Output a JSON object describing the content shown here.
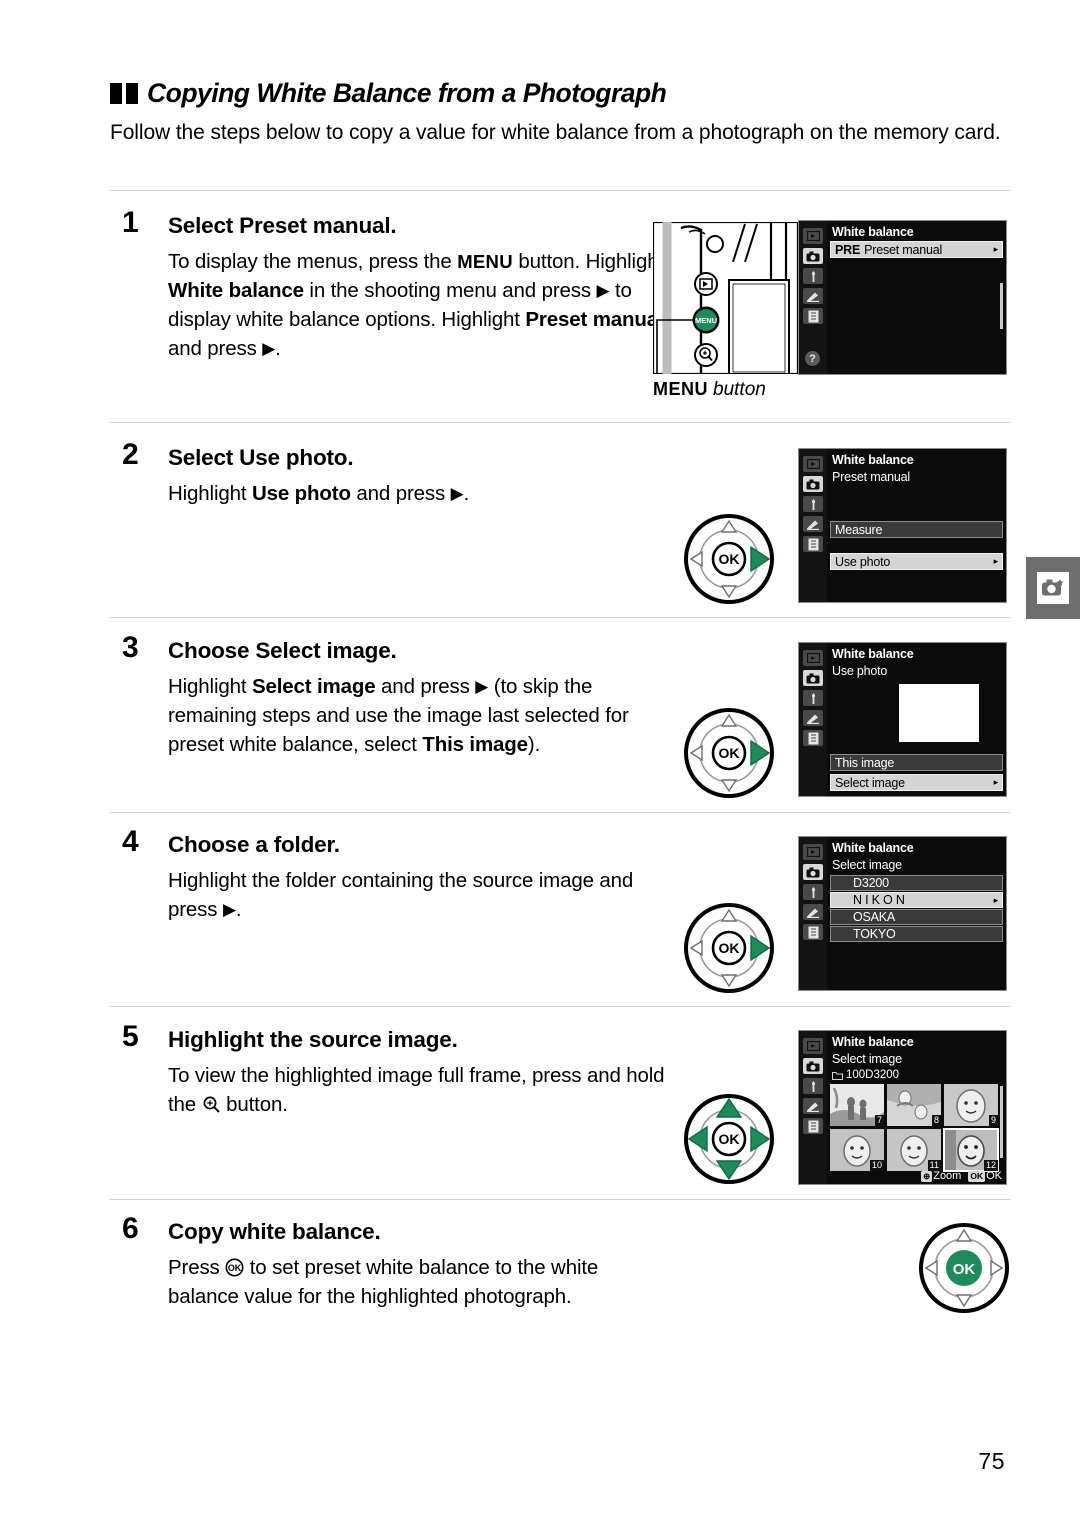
{
  "heading": {
    "title": "Copying White Balance from a Photograph",
    "intro": "Follow the steps below to copy a value for white balance from a photograph on the memory card."
  },
  "page_number": "75",
  "menu_caption": {
    "button": "MENU",
    "label": "button"
  },
  "steps": [
    {
      "number": "1",
      "title_prefix": "Select ",
      "title_bold": "Preset manual",
      "title_suffix": ".",
      "body": "To display the menus, press the MENU button. Highlight White balance in the shooting menu and press ▶ to display white balance options. Highlight Preset manual and press ▶."
    },
    {
      "number": "2",
      "title_prefix": "Select ",
      "title_bold": "Use photo",
      "title_suffix": ".",
      "body": "Highlight Use photo and press ▶."
    },
    {
      "number": "3",
      "title_prefix": "Choose ",
      "title_bold": "Select image",
      "title_suffix": ".",
      "body": "Highlight Select image and press ▶ (to skip the remaining steps and use the image last selected for preset white balance, select This image)."
    },
    {
      "number": "4",
      "title_prefix": "Choose a folder.",
      "title_bold": "",
      "title_suffix": "",
      "body": "Highlight the folder containing the source image and press ▶."
    },
    {
      "number": "5",
      "title_prefix": "Highlight the source image.",
      "title_bold": "",
      "title_suffix": "",
      "body": "To view the highlighted image full frame, press and hold the ⊕ button."
    },
    {
      "number": "6",
      "title_prefix": "Copy white balance.",
      "title_bold": "",
      "title_suffix": "",
      "body": "Press ⒪ to set preset white balance to the white balance value for the highlighted photograph."
    }
  ],
  "screens": {
    "screen1": {
      "title": "White balance",
      "rows": [
        {
          "badge": "PRE",
          "label": "Preset manual",
          "arrow": "▸"
        }
      ],
      "help": "?"
    },
    "screen2": {
      "title": "White balance",
      "subtitle": "Preset manual",
      "rows": [
        {
          "label": "Measure",
          "arrow": ""
        },
        {
          "label": "Use photo",
          "arrow": "▸"
        }
      ]
    },
    "screen3": {
      "title": "White balance",
      "subtitle": "Use photo",
      "rows": [
        {
          "label": "This image",
          "arrow": ""
        },
        {
          "label": "Select image",
          "arrow": "▸"
        }
      ]
    },
    "screen4": {
      "title": "White balance",
      "subtitle": "Select image",
      "folders": [
        {
          "label": "D3200",
          "arrow": ""
        },
        {
          "label": "N I K O N",
          "arrow": "▸"
        },
        {
          "label": "OSAKA",
          "arrow": ""
        },
        {
          "label": "TOKYO",
          "arrow": ""
        }
      ]
    },
    "screen5": {
      "title": "White balance",
      "subtitle": "Select image",
      "folder": "100D3200",
      "thumbnails": [
        {
          "number": "7"
        },
        {
          "number": "8"
        },
        {
          "number": "9"
        },
        {
          "number": "10"
        },
        {
          "number": "11"
        },
        {
          "number": "12"
        }
      ],
      "footer": {
        "zoom_key": "⊕",
        "zoom_label": "Zoom",
        "ok_key": "OK",
        "ok_label": "OK"
      }
    }
  },
  "colors": {
    "accent_green": "#1f8a5a",
    "tab_gray": "#6e6e6e",
    "rule_gray": "#cfcfcf"
  }
}
